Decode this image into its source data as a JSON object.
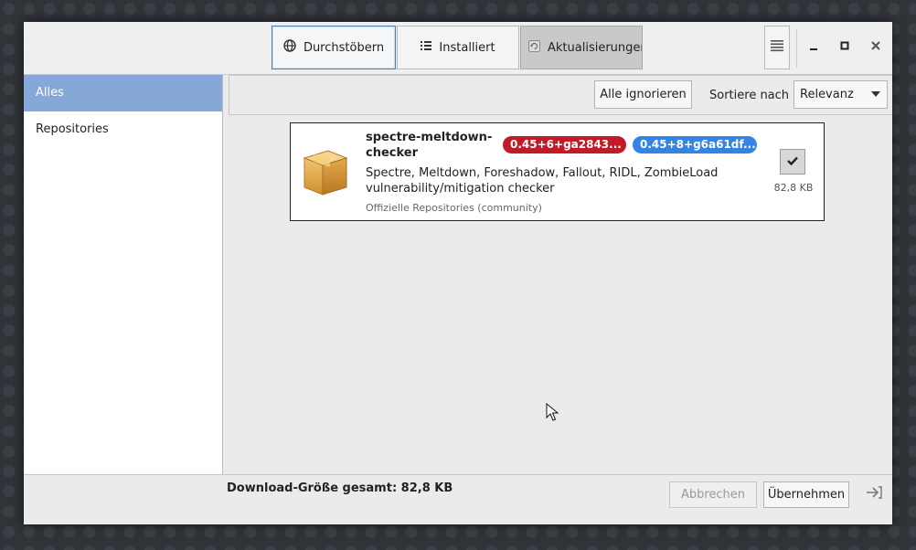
{
  "header": {
    "tabs": [
      {
        "label": "Durchstöbern",
        "icon": "globe-icon"
      },
      {
        "label": "Installiert",
        "icon": "list-icon"
      },
      {
        "label": "Aktualisierungen",
        "icon": "refresh-icon"
      }
    ],
    "menu_icon": "hamburger-icon",
    "window_controls": [
      "minimize-icon",
      "maximize-icon",
      "close-icon"
    ]
  },
  "sidebar": {
    "items": [
      {
        "label": "Alles",
        "active": true
      },
      {
        "label": "Repositories",
        "active": false
      }
    ]
  },
  "toolbar": {
    "ignore_all_label": "Alle ignorieren",
    "sort_label": "Sortiere nach",
    "sort_value": "Relevanz"
  },
  "updates": [
    {
      "name": "spectre-meltdown-checker",
      "current_version": "0.45+6+ga2843...",
      "new_version": "0.45+8+g6a61df...",
      "description": "Spectre, Meltdown, Foreshadow, Fallout, RIDL, ZombieLoad vulnerability/mitigation checker",
      "repository": "Offizielle Repositories (community)",
      "size": "82,8 KB",
      "selected": true
    }
  ],
  "footer": {
    "total_label": "Download-Größe gesamt: 82,8 KB",
    "cancel_label": "Abbrechen",
    "apply_label": "Übernehmen"
  },
  "colors": {
    "accent": "#86a8d8",
    "old_version_badge": "#c01c28",
    "new_version_badge": "#3584e4"
  }
}
